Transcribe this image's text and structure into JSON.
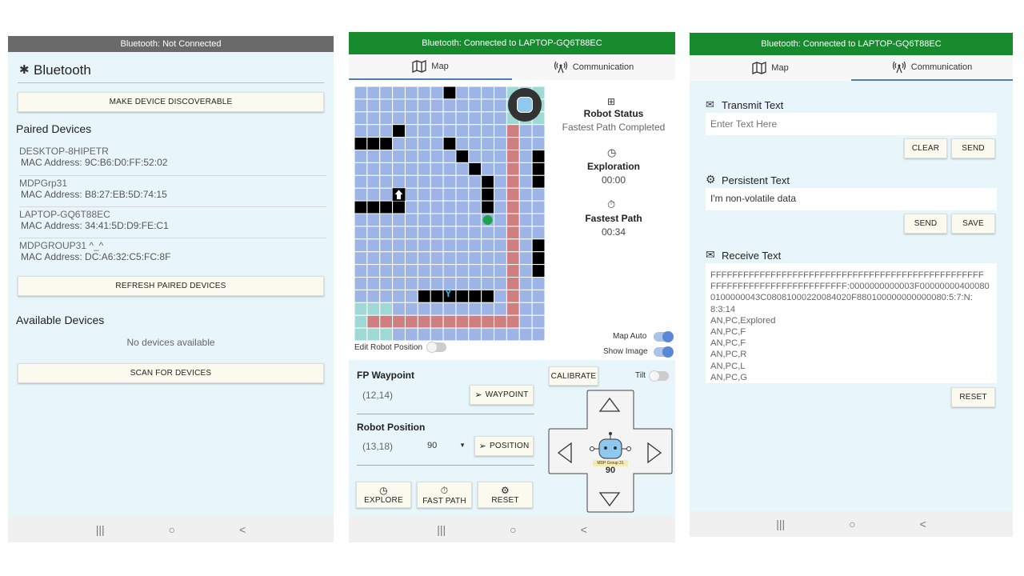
{
  "phone1": {
    "status": "Bluetooth: Not Connected",
    "title": "Bluetooth",
    "discoverable_btn": "MAKE DEVICE DISCOVERABLE",
    "paired_heading": "Paired Devices",
    "paired": [
      {
        "name": "DESKTOP-8HIPETR",
        "mac": "MAC Address: 9C:B6:D0:FF:52:02"
      },
      {
        "name": "MDPGrp31",
        "mac": "MAC Address: B8:27:EB:5D:74:15"
      },
      {
        "name": "LAPTOP-GQ6T88EC",
        "mac": "MAC Address: 34:41:5D:D9:FE:C1"
      },
      {
        "name": "MDPGROUP31 ^_^",
        "mac": "MAC Address: DC:A6:32:C5:FC:8F"
      }
    ],
    "refresh_btn": "REFRESH PAIRED DEVICES",
    "available_heading": "Available Devices",
    "no_devices": "No devices available",
    "scan_btn": "SCAN FOR DEVICES"
  },
  "phone2": {
    "status": "Bluetooth: Connected to LAPTOP-GQ6T88EC",
    "tab_map": "Map",
    "tab_comm": "Communication",
    "robot_status_label": "Robot Status",
    "robot_status_value": "Fastest Path Completed",
    "exploration_label": "Exploration",
    "exploration_time": "00:00",
    "fastest_label": "Fastest Path",
    "fastest_time": "00:34",
    "map_auto": "Map Auto",
    "show_image": "Show Image",
    "edit_robot": "Edit Robot Position",
    "waypoint_label": "FP Waypoint",
    "waypoint_value": "(12,14)",
    "waypoint_btn": "WAYPOINT",
    "robotpos_label": "Robot Position",
    "robotpos_value": "(13,18)",
    "direction": "90",
    "position_btn": "POSITION",
    "calibrate_btn": "CALIBRATE",
    "tilt": "Tilt",
    "explore_btn": "EXPLORE",
    "fastpath_btn": "FAST PATH",
    "reset_btn": "RESET",
    "robot_badge": "MDP Group 31",
    "dpad_value": "90",
    "grid_marker": "Y"
  },
  "phone3": {
    "status": "Bluetooth: Connected to LAPTOP-GQ6T88EC",
    "tab_map": "Map",
    "tab_comm": "Communication",
    "transmit_label": "Transmit Text",
    "transmit_placeholder": "Enter Text Here",
    "clear_btn": "CLEAR",
    "send_btn": "SEND",
    "persistent_label": "Persistent Text",
    "persistent_value": "I'm non-volatile data",
    "send2_btn": "SEND",
    "save_btn": "SAVE",
    "receive_label": "Receive Text",
    "receive_lines": [
      "FFFFFFFFFFFFFFFFFFFFFFFFFFFFFFFFFFFFFFFFFFFFFFFFFF",
      "FFFFFFFFFFFFFFFFFFFFFFFFF:0000000000003F00000000400080",
      "0100000043C08081000220084020F880100000000000080:5:7:N:",
      "8:3:14",
      "AN,PC,Explored",
      "AN,PC,F",
      "AN,PC,F",
      "AN,PC,R",
      "AN,PC,L",
      "AN,PC,G"
    ],
    "reset_btn": "RESET"
  },
  "nav": {
    "recent": "|||",
    "home": "○",
    "back": "<"
  },
  "colors": {
    "connected": "#178a2e",
    "disconnected": "#6a6a6a",
    "grid_explored": "#9cb5e6",
    "grid_path": "#cf7f80",
    "grid_start": "#9fd9d6",
    "obstacle": "#000000"
  }
}
